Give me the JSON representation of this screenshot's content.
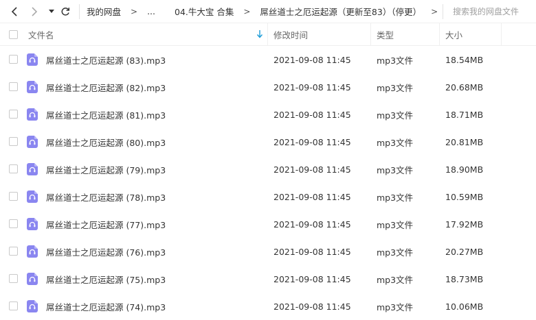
{
  "breadcrumb": {
    "items": [
      "我的网盘",
      "...",
      "04.牛大宝 合集",
      "屌丝道士之厄运起源（更新至83）（停更）"
    ],
    "sep": ">"
  },
  "search": {
    "placeholder": "搜索我的网盘文件"
  },
  "columns": {
    "name": "文件名",
    "modified": "修改时间",
    "type": "类型",
    "size": "大小"
  },
  "files": [
    {
      "name": "屌丝道士之厄运起源 (83).mp3",
      "modified": "2021-09-08 11:45",
      "type": "mp3文件",
      "size": "18.54MB"
    },
    {
      "name": "屌丝道士之厄运起源 (82).mp3",
      "modified": "2021-09-08 11:45",
      "type": "mp3文件",
      "size": "20.68MB"
    },
    {
      "name": "屌丝道士之厄运起源 (81).mp3",
      "modified": "2021-09-08 11:45",
      "type": "mp3文件",
      "size": "18.71MB"
    },
    {
      "name": "屌丝道士之厄运起源 (80).mp3",
      "modified": "2021-09-08 11:45",
      "type": "mp3文件",
      "size": "20.81MB"
    },
    {
      "name": "屌丝道士之厄运起源 (79).mp3",
      "modified": "2021-09-08 11:45",
      "type": "mp3文件",
      "size": "18.90MB"
    },
    {
      "name": "屌丝道士之厄运起源 (78).mp3",
      "modified": "2021-09-08 11:45",
      "type": "mp3文件",
      "size": "10.59MB"
    },
    {
      "name": "屌丝道士之厄运起源 (77).mp3",
      "modified": "2021-09-08 11:45",
      "type": "mp3文件",
      "size": "17.92MB"
    },
    {
      "name": "屌丝道士之厄运起源 (76).mp3",
      "modified": "2021-09-08 11:45",
      "type": "mp3文件",
      "size": "20.27MB"
    },
    {
      "name": "屌丝道士之厄运起源 (75).mp3",
      "modified": "2021-09-08 11:45",
      "type": "mp3文件",
      "size": "18.73MB"
    },
    {
      "name": "屌丝道士之厄运起源 (74).mp3",
      "modified": "2021-09-08 11:45",
      "type": "mp3文件",
      "size": "10.06MB"
    }
  ],
  "icons": {
    "back": "chevron-left-icon",
    "forward": "chevron-right-icon",
    "history": "caret-down-icon",
    "refresh": "refresh-icon",
    "sort": "sort-down-arrow-icon",
    "file": "audio-file-icon"
  },
  "colors": {
    "accent": "#1a9bd7",
    "audio_icon": "#8a86f0"
  }
}
